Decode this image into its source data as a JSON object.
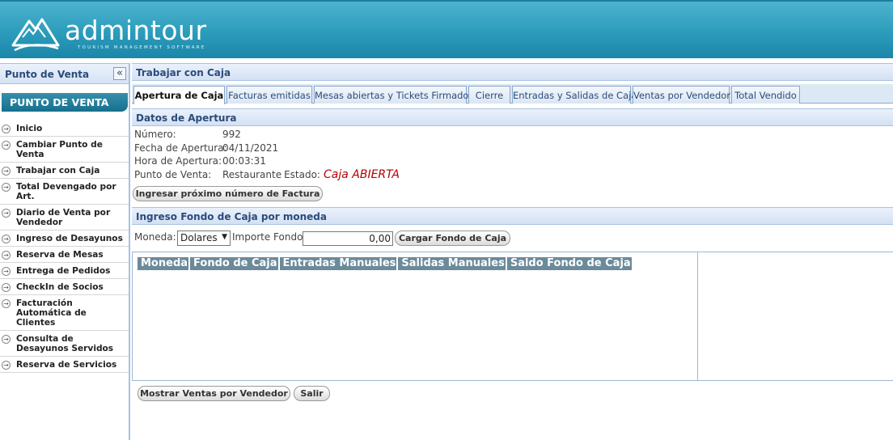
{
  "header": {
    "brand": "admintour",
    "tagline": "TOURISM MANAGEMENT SOFTWARE",
    "colors": {
      "header_bg": "#2c9cbc",
      "accent": "#2b4b7b",
      "status_open": "#b50000"
    }
  },
  "sidebar": {
    "title": "Punto de Venta",
    "collapse_icon": "«",
    "section_title": "PUNTO DE VENTA",
    "items": [
      {
        "label": "Inicio"
      },
      {
        "label": "Cambiar Punto de Venta"
      },
      {
        "label": "Trabajar con Caja"
      },
      {
        "label": "Total Devengado por Art."
      },
      {
        "label": "Diario de Venta por Vendedor"
      },
      {
        "label": "Ingreso de Desayunos"
      },
      {
        "label": "Reserva de Mesas"
      },
      {
        "label": "Entrega de Pedidos"
      },
      {
        "label": "CheckIn de Socios"
      },
      {
        "label": "Facturación Automática de Clientes"
      },
      {
        "label": "Consulta de Desayunos Servidos"
      },
      {
        "label": "Reserva de Servicios"
      }
    ]
  },
  "main": {
    "title": "Trabajar con Caja",
    "tabs": [
      {
        "label": "Apertura de Caja",
        "active": true
      },
      {
        "label": "Facturas emitidas"
      },
      {
        "label": "Mesas abiertas y Tickets Firmados"
      },
      {
        "label": "Cierre"
      },
      {
        "label": "Entradas y Salidas de Caja"
      },
      {
        "label": "Ventas por Vendedor"
      },
      {
        "label": "Total Vendido"
      }
    ],
    "apertura": {
      "title": "Datos de Apertura",
      "numero_label": "Número:",
      "numero_value": "992",
      "fecha_label": "Fecha de Apertura:",
      "fecha_value": "04/11/2021",
      "hora_label": "Hora de Apertura:",
      "hora_value": "00:03:31",
      "punto_label": "Punto de Venta:",
      "punto_value": "Restaurante",
      "estado_label": "Estado:",
      "estado_value": "Caja ABIERTA",
      "next_invoice_button": "Ingresar próximo número de Factura"
    },
    "fondo": {
      "title": "Ingreso Fondo de Caja por moneda",
      "moneda_label": "Moneda:",
      "moneda_value": "Dolares",
      "importe_label": "Importe Fondo:",
      "importe_value": "0,00",
      "cargar_button": "Cargar Fondo de Caja",
      "columns": [
        "Moneda",
        "Fondo de Caja",
        "Entradas Manuales",
        "Salidas Manuales",
        "Saldo Fondo de Caja"
      ]
    },
    "buttons": {
      "mostrar": "Mostrar Ventas por Vendedor",
      "salir": "Salir"
    }
  }
}
